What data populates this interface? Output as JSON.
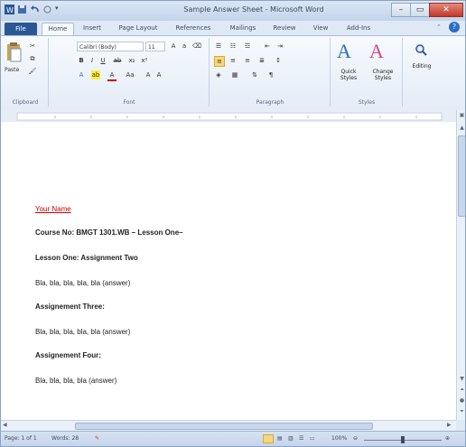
{
  "window": {
    "title": "Sample Answer Sheet - Microsoft Word",
    "buttons": {
      "minimize": "–",
      "restore": "▭",
      "close": "✕"
    }
  },
  "tabs": [
    "File",
    "Home",
    "Insert",
    "Page Layout",
    "References",
    "Mailings",
    "Review",
    "View",
    "Add-Ins"
  ],
  "ribbon": {
    "clipboard": {
      "label": "Clipboard",
      "paste": "Paste"
    },
    "font": {
      "label": "Font",
      "font_name": "Calibri (Body)",
      "font_size": "11"
    },
    "paragraph": {
      "label": "Paragraph"
    },
    "styles": {
      "label": "Styles",
      "quick_styles": "Quick Styles",
      "change_styles": "Change Styles"
    },
    "editing": {
      "label": "Editing"
    }
  },
  "document": {
    "your_name": "Your Name",
    "course": "Course No: BMGT 1301.WB – Lesson One–",
    "assignment_two": "Lesson One: Assignment Two",
    "answer_1": "Bla, bla, bla, bla, bla (answer)",
    "assignment_three": "Assignement Three:",
    "answer_2": "Bla, bla, bla, bla, bla (answer)",
    "assignment_four": "Assignement Four:",
    "answer_3": "Bla, bla, bla, bla (answer)"
  },
  "status": {
    "page": "Page: 1 of 1",
    "words": "Words: 28",
    "zoom": "100%"
  },
  "colors": {
    "accent": "#2b5797",
    "name_red": "#cc0000"
  }
}
